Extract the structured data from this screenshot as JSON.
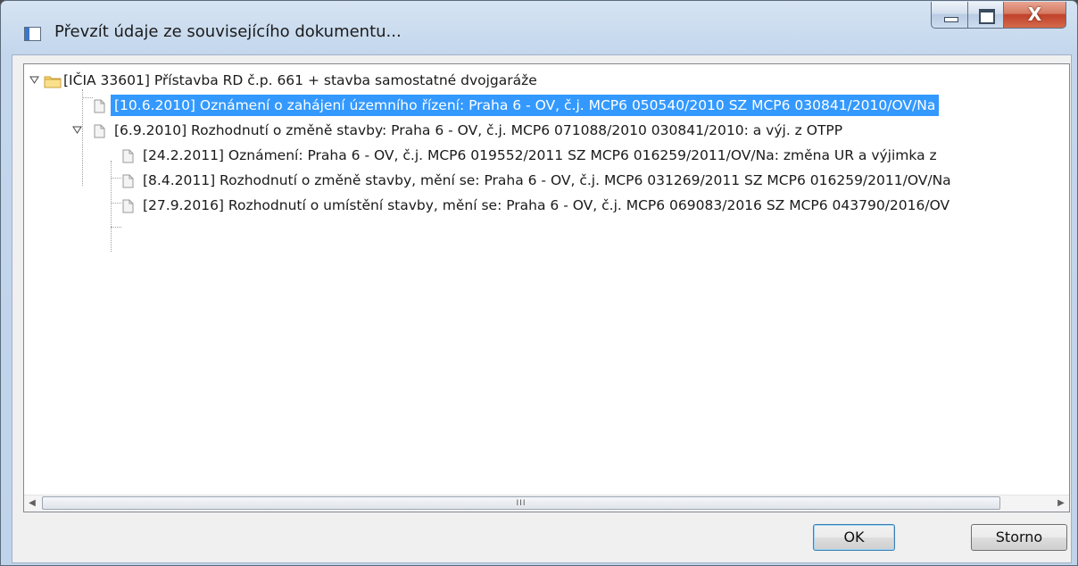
{
  "window": {
    "title": "Převzít údaje ze souvisejícího dokumentu...",
    "close_glyph": "X"
  },
  "tree": {
    "root": {
      "label": "[IČIA 33601] Přístavba RD č.p. 661 + stavba samostatné dvojgaráže",
      "icon": "folder-icon",
      "expanded": true
    },
    "items": [
      {
        "label": "[10.6.2010] Oznámení o zahájení územního řízení: Praha 6 - OV, č.j. MCP6 050540/2010 SZ MCP6 030841/2010/OV/Na",
        "selected": true,
        "icon": "document-icon"
      },
      {
        "label": "[6.9.2010] Rozhodnutí o změně stavby: Praha 6 - OV, č.j. MCP6 071088/2010 030841/2010: a výj. z OTPP",
        "expanded": true,
        "icon": "document-icon",
        "children": [
          {
            "label": "[24.2.2011] Oznámení: Praha 6 - OV, č.j. MCP6 019552/2011  SZ MCP6 016259/2011/OV/Na: změna UR a výjimka z",
            "icon": "document-icon"
          },
          {
            "label": "[8.4.2011] Rozhodnutí o změně stavby, mění se: Praha 6 - OV, č.j. MCP6 031269/2011 SZ MCP6 016259/2011/OV/Na",
            "icon": "document-icon"
          },
          {
            "label": "[27.9.2016] Rozhodnutí o umístění stavby, mění se: Praha 6 - OV, č.j. MCP6 069083/2016 SZ MCP6 043790/2016/OV",
            "icon": "document-icon"
          }
        ]
      }
    ]
  },
  "scrollbar": {
    "grip": "III"
  },
  "buttons": {
    "ok": "OK",
    "cancel": "Storno"
  },
  "colors": {
    "selection": "#3399ff",
    "accent": "#3c7fb1"
  }
}
